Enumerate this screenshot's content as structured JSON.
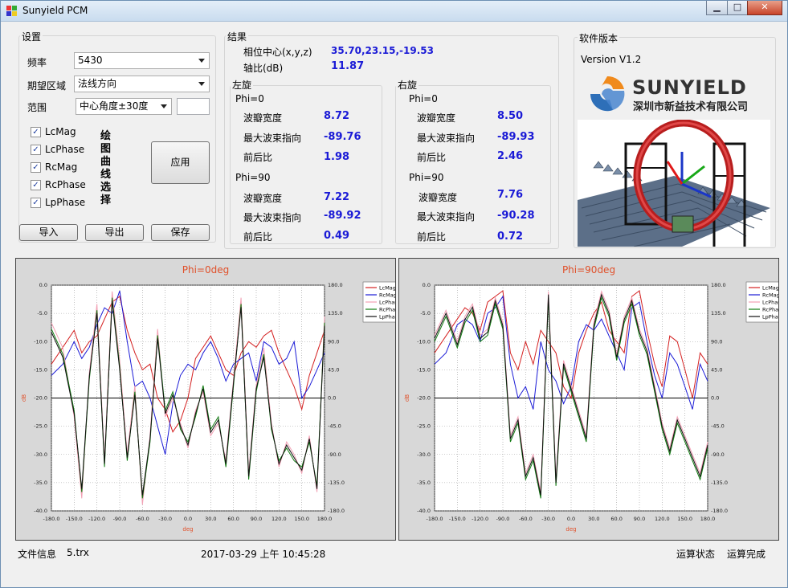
{
  "window": {
    "title": "Sunyield PCM",
    "controls": {
      "minimize": "▁",
      "maximize": "□",
      "close": "✕"
    }
  },
  "settings": {
    "group_label": "设置",
    "freq_label": "频率",
    "freq_value": "5430",
    "region_label": "期望区域",
    "region_value": "法线方向",
    "range_label": "范围",
    "range_value": "中心角度±30度",
    "range_extra": "",
    "checkboxes": [
      {
        "label": "LcMag",
        "checked": true
      },
      {
        "label": "LcPhase",
        "checked": true
      },
      {
        "label": "RcMag",
        "checked": true
      },
      {
        "label": "RcPhase",
        "checked": true
      },
      {
        "label": "LpPhase",
        "checked": true
      }
    ],
    "curve_caption_chars": [
      "绘",
      "图",
      "曲",
      "线",
      "选",
      "择"
    ],
    "apply_label": "应用",
    "import_label": "导入",
    "export_label": "导出",
    "save_label": "保存"
  },
  "results": {
    "group_label": "结果",
    "phase_center_label": "相位中心(x,y,z)",
    "phase_center_value": "35.70,23.15,-19.53",
    "axial_ratio_label": "轴比(dB)",
    "axial_ratio_value": "11.87",
    "left": {
      "label": "左旋",
      "phi0": {
        "title": "Phi=0",
        "bw_label": "波瓣宽度",
        "bw": "8.72",
        "dir_label": "最大波束指向",
        "dir": "-89.76",
        "fb_label": "前后比",
        "fb": "1.98"
      },
      "phi90": {
        "title": "Phi=90",
        "bw_label": "波瓣宽度",
        "bw": "7.22",
        "dir_label": "最大波束指向",
        "dir": "-89.92",
        "fb_label": "前后比",
        "fb": "0.49"
      }
    },
    "right": {
      "label": "右旋",
      "phi0": {
        "title": "Phi=0",
        "bw_label": "波瓣宽度",
        "bw": "8.50",
        "dir_label": "最大波束指向",
        "dir": "-89.93",
        "fb_label": "前后比",
        "fb": "2.46"
      },
      "phi90": {
        "title": "Phi=90",
        "bw_label": "波瓣宽度",
        "bw": "7.76",
        "dir_label": "最大波束指向",
        "dir": "-90.28",
        "fb_label": "前后比",
        "fb": "0.72"
      }
    }
  },
  "version": {
    "group_label": "软件版本",
    "text": "Version V1.2",
    "logo_name": "SUNYIELD",
    "logo_company": "深圳市新益技术有限公司"
  },
  "status": {
    "file_label": "文件信息",
    "file_name": "5.trx",
    "datetime": "2017-03-29 上午 10:45:28",
    "state_label": "运算状态",
    "state_value": "运算完成"
  },
  "colors": {
    "LcMag": "#d42020",
    "RcMag": "#1a1ad6",
    "LcPhase": "#f2a0b4",
    "RcPhase": "#0f7a0f",
    "LpPhase": "#101010",
    "title": "#e0502a",
    "value": "#1a1ad6"
  },
  "chart_data": [
    {
      "type": "line",
      "title": "Phi=0deg",
      "xlabel": "deg",
      "ylabel": "dB",
      "xlim": [
        -180,
        180
      ],
      "ylim": [
        -40,
        0
      ],
      "y2lim": [
        -180,
        180
      ],
      "x_ticks": [
        "-180.0",
        "-150.0",
        "-120.0",
        "-90.0",
        "-60.0",
        "-30.0",
        "0.0",
        "30.0",
        "60.0",
        "90.0",
        "120.0",
        "150.0",
        "180.0"
      ],
      "y_ticks": [
        "0.0",
        "-5.0",
        "-10.0",
        "-15.0",
        "-20.0",
        "-25.0",
        "-30.0",
        "-35.0",
        "-40.0"
      ],
      "y2_ticks": [
        "180.0",
        "135.0",
        "90.0",
        "45.0",
        "0.0",
        "-45.0",
        "-90.0",
        "-135.0",
        "-180.0"
      ],
      "grid": true,
      "legend": "top-right",
      "x": [
        -180,
        -165,
        -150,
        -140,
        -130,
        -120,
        -110,
        -100,
        -90,
        -80,
        -70,
        -60,
        -50,
        -40,
        -30,
        -20,
        -10,
        0,
        10,
        20,
        30,
        40,
        50,
        60,
        70,
        80,
        90,
        100,
        110,
        120,
        130,
        140,
        150,
        160,
        170,
        180
      ],
      "series": [
        {
          "name": "LcMag",
          "y_axis": "left",
          "values": [
            -14,
            -11,
            -8,
            -12,
            -10,
            -9,
            -6,
            -3,
            -2,
            -8,
            -12,
            -15,
            -14,
            -20,
            -22,
            -26,
            -24,
            -20,
            -13,
            -11,
            -9,
            -12,
            -15,
            -16,
            -12,
            -10,
            -11,
            -9,
            -8,
            -12,
            -15,
            -18,
            -22,
            -16,
            -12,
            -8
          ]
        },
        {
          "name": "RcMag",
          "y_axis": "left",
          "values": [
            -16,
            -14,
            -10,
            -13,
            -11,
            -7,
            -4,
            -5,
            -1,
            -10,
            -18,
            -17,
            -20,
            -25,
            -30,
            -21,
            -16,
            -14,
            -15,
            -12,
            -10,
            -13,
            -17,
            -14,
            -13,
            -12,
            -17,
            -10,
            -11,
            -14,
            -13,
            -10,
            -20,
            -18,
            -15,
            -12
          ]
        },
        {
          "name": "LcPhase",
          "y_axis": "right",
          "values": [
            120,
            80,
            -30,
            -160,
            40,
            150,
            -100,
            170,
            60,
            -90,
            20,
            -170,
            -60,
            110,
            -30,
            0,
            -40,
            -80,
            -20,
            10,
            -60,
            -40,
            -100,
            30,
            160,
            -120,
            20,
            80,
            -40,
            -110,
            -70,
            -90,
            -120,
            -60,
            -150,
            130
          ]
        },
        {
          "name": "RcPhase",
          "y_axis": "right",
          "values": [
            110,
            70,
            -20,
            -150,
            30,
            140,
            -110,
            160,
            50,
            -100,
            10,
            -160,
            -70,
            100,
            -20,
            10,
            -50,
            -70,
            -30,
            20,
            -50,
            -30,
            -110,
            20,
            150,
            -130,
            10,
            70,
            -50,
            -100,
            -80,
            -100,
            -110,
            -70,
            -140,
            120
          ]
        },
        {
          "name": "LpPhase",
          "y_axis": "right",
          "values": [
            105,
            65,
            -25,
            -145,
            35,
            135,
            -105,
            155,
            45,
            -95,
            5,
            -155,
            -65,
            95,
            -25,
            5,
            -45,
            -75,
            -25,
            15,
            -55,
            -35,
            -105,
            25,
            145,
            -125,
            15,
            65,
            -45,
            -105,
            -75,
            -95,
            -115,
            -65,
            -145,
            115
          ]
        }
      ]
    },
    {
      "type": "line",
      "title": "Phi=90deg",
      "xlabel": "deg",
      "ylabel": "dB",
      "xlim": [
        -180,
        180
      ],
      "ylim": [
        -40,
        0
      ],
      "y2lim": [
        -180,
        180
      ],
      "x_ticks": [
        "-180.0",
        "-150.0",
        "-120.0",
        "-90.0",
        "-60.0",
        "-30.0",
        "0.0",
        "30.0",
        "60.0",
        "90.0",
        "120.0",
        "150.0",
        "180.0"
      ],
      "y_ticks": [
        "0.0",
        "-5.0",
        "-10.0",
        "-15.0",
        "-20.0",
        "-25.0",
        "-30.0",
        "-35.0",
        "-40.0"
      ],
      "y2_ticks": [
        "180.0",
        "135.0",
        "90.0",
        "45.0",
        "0.0",
        "-45.0",
        "-90.0",
        "-135.0",
        "-180.0"
      ],
      "grid": true,
      "legend": "top-right",
      "x": [
        -180,
        -165,
        -150,
        -140,
        -130,
        -120,
        -110,
        -100,
        -90,
        -80,
        -70,
        -60,
        -50,
        -40,
        -30,
        -20,
        -10,
        0,
        10,
        20,
        30,
        40,
        50,
        60,
        70,
        80,
        90,
        100,
        110,
        120,
        130,
        140,
        150,
        160,
        170,
        180
      ],
      "series": [
        {
          "name": "LcMag",
          "y_axis": "left",
          "values": [
            -12,
            -9,
            -6,
            -4,
            -5,
            -8,
            -3,
            -2,
            -1,
            -12,
            -15,
            -10,
            -14,
            -8,
            -10,
            -12,
            -18,
            -20,
            -12,
            -8,
            -5,
            -3,
            -8,
            -10,
            -12,
            -2,
            -1,
            -8,
            -14,
            -18,
            -9,
            -10,
            -15,
            -20,
            -12,
            -14
          ]
        },
        {
          "name": "RcMag",
          "y_axis": "left",
          "values": [
            -14,
            -12,
            -7,
            -6,
            -7,
            -10,
            -5,
            -4,
            -2,
            -14,
            -20,
            -18,
            -22,
            -10,
            -15,
            -17,
            -21,
            -18,
            -10,
            -7,
            -8,
            -6,
            -9,
            -12,
            -15,
            -4,
            -3,
            -10,
            -16,
            -20,
            -12,
            -14,
            -18,
            -22,
            -14,
            -17
          ]
        },
        {
          "name": "LcPhase",
          "y_axis": "right",
          "values": [
            100,
            140,
            90,
            130,
            150,
            100,
            110,
            160,
            120,
            -60,
            -30,
            -120,
            -90,
            -150,
            170,
            -130,
            60,
            20,
            -20,
            -60,
            120,
            170,
            140,
            70,
            130,
            160,
            110,
            80,
            20,
            -40,
            -80,
            -30,
            -60,
            -90,
            -120,
            -70
          ]
        },
        {
          "name": "RcPhase",
          "y_axis": "right",
          "values": [
            90,
            130,
            80,
            120,
            140,
            90,
            100,
            150,
            110,
            -70,
            -40,
            -130,
            -100,
            -160,
            160,
            -140,
            50,
            10,
            -30,
            -70,
            110,
            160,
            130,
            60,
            120,
            150,
            100,
            70,
            10,
            -50,
            -90,
            -40,
            -70,
            -100,
            -130,
            -80
          ]
        },
        {
          "name": "LpPhase",
          "y_axis": "right",
          "values": [
            95,
            135,
            85,
            125,
            145,
            95,
            105,
            155,
            115,
            -65,
            -35,
            -125,
            -95,
            -155,
            165,
            -135,
            55,
            15,
            -25,
            -65,
            115,
            165,
            135,
            65,
            125,
            155,
            105,
            75,
            15,
            -45,
            -85,
            -35,
            -65,
            -95,
            -125,
            -75
          ]
        }
      ]
    }
  ]
}
